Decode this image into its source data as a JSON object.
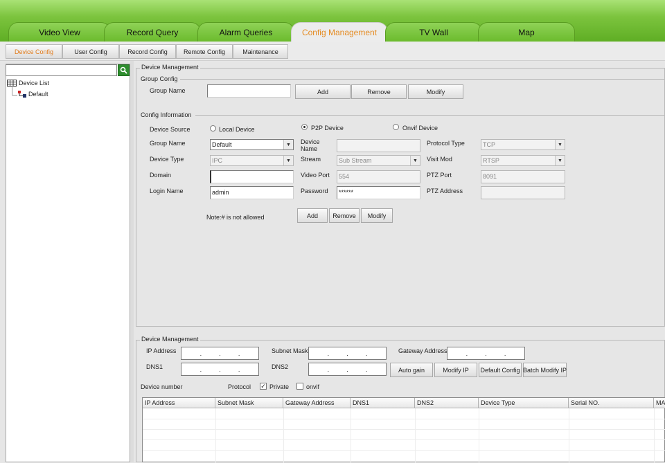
{
  "tabs": [
    "Video View",
    "Record Query",
    "Alarm Queries",
    "Config Management",
    "TV Wall",
    "Map"
  ],
  "active_tab": "Config Management",
  "subtabs": [
    "Device Config",
    "User Config",
    "Record Config",
    "Remote Config",
    "Maintenance"
  ],
  "active_subtab": "Device Config",
  "tree": {
    "root": "Device List",
    "child": "Default"
  },
  "device_mgmt": {
    "title": "Device Management",
    "group_config": {
      "title": "Group Config",
      "group_name_label": "Group Name",
      "group_name_value": "",
      "add": "Add",
      "remove": "Remove",
      "modify": "Modify"
    },
    "config_info": {
      "title": "Config Information",
      "device_source_label": "Device Source",
      "local_device": "Local Device",
      "p2p_device": "P2P Device",
      "onvif_device": "Onvif Device",
      "group_name_label": "Group Name",
      "group_name_value": "Default",
      "device_name_label": "Device Name",
      "device_name_value": "",
      "protocol_type_label": "Protocol Type",
      "protocol_type_value": "TCP",
      "device_type_label": "Device Type",
      "device_type_value": "IPC",
      "stream_label": "Stream",
      "stream_value": "Sub Stream",
      "visit_mod_label": "Visit Mod",
      "visit_mod_value": "RTSP",
      "domain_label": "Domain",
      "domain_value": "",
      "video_port_label": "Video Port",
      "video_port_value": "554",
      "ptz_port_label": "PTZ Port",
      "ptz_port_value": "8091",
      "login_name_label": "Login Name",
      "login_name_value": "admin",
      "password_label": "Password",
      "password_value": "******",
      "ptz_address_label": "PTZ Address",
      "ptz_address_value": "",
      "note": "Note:# is not allowed",
      "add": "Add",
      "remove": "Remove",
      "modify": "Modify"
    }
  },
  "lower": {
    "title": "Device Management",
    "ip_address_label": "IP Address",
    "subnet_mask_label": "Subnet Mask",
    "gateway_label": "Gateway Address",
    "dns1_label": "DNS1",
    "dns2_label": "DNS2",
    "auto_gain": "Auto gain",
    "modify_ip": "Modify IP",
    "default_config": "Default Config",
    "batch_modify_ip": "Batch Modify IP",
    "device_number_label": "Device number",
    "protocol_label": "Protocol",
    "private_label": "Private",
    "onvif_label": "onvif",
    "columns": [
      "IP Address",
      "Subnet Mask",
      "Gateway Address",
      "DNS1",
      "DNS2",
      "Device Type",
      "Serial NO.",
      "MA"
    ]
  }
}
